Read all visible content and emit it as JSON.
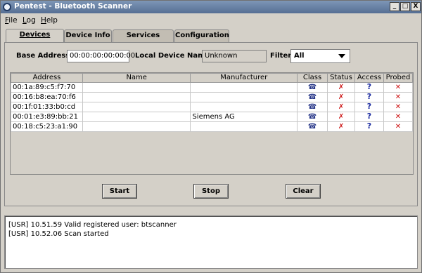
{
  "window": {
    "title": "Pentest - Bluetooth Scanner",
    "controls": {
      "minimize": "_",
      "maximize": "□",
      "close": "X"
    }
  },
  "menu": [
    {
      "label": "File",
      "mnemonic": "F",
      "rest": "ile"
    },
    {
      "label": "Log",
      "mnemonic": "L",
      "rest": "og"
    },
    {
      "label": "Help",
      "mnemonic": "H",
      "rest": "elp"
    }
  ],
  "tabs": [
    {
      "label": "Devices Found",
      "active": true
    },
    {
      "label": "Device Info",
      "active": false
    },
    {
      "label": "Services Found",
      "active": false
    },
    {
      "label": "Configuration",
      "active": false
    }
  ],
  "form": {
    "base_address_label": "Base Address:",
    "base_address_value": "00:00:00:00:00:00",
    "local_name_label": "Local Device Name:",
    "local_name_value": "Unknown",
    "filter_label": "Filter:",
    "filter_value": "All"
  },
  "table": {
    "columns": [
      "Address",
      "Name",
      "Manufacturer",
      "Class",
      "Status",
      "Access",
      "Probed"
    ],
    "rows": [
      {
        "address": "00:1a:89:c5:f7:70",
        "name": "",
        "manufacturer": ""
      },
      {
        "address": "00:16:b8:ea:70:f6",
        "name": "",
        "manufacturer": ""
      },
      {
        "address": "00:1f:01:33:b0:cd",
        "name": "",
        "manufacturer": ""
      },
      {
        "address": "00:01:e3:89:bb:21",
        "name": "",
        "manufacturer": "Siemens AG"
      },
      {
        "address": "00:18:c5:23:a1:90",
        "name": "",
        "manufacturer": ""
      }
    ],
    "icons": {
      "class": "phone-icon",
      "status": "disconnected-icon",
      "access": "question-icon",
      "probed": "red-x-icon"
    }
  },
  "buttons": {
    "start": "Start",
    "stop": "Stop",
    "clear": "Clear"
  },
  "log": [
    "[USR] 10.51.59 Valid registered user: btscanner",
    "[USR] 10.52.06 Scan started"
  ],
  "colors": {
    "titlebar": "#566f94",
    "panel": "#d4d0c8",
    "x_red": "#cc1111",
    "question_blue": "#1a2aa0"
  }
}
